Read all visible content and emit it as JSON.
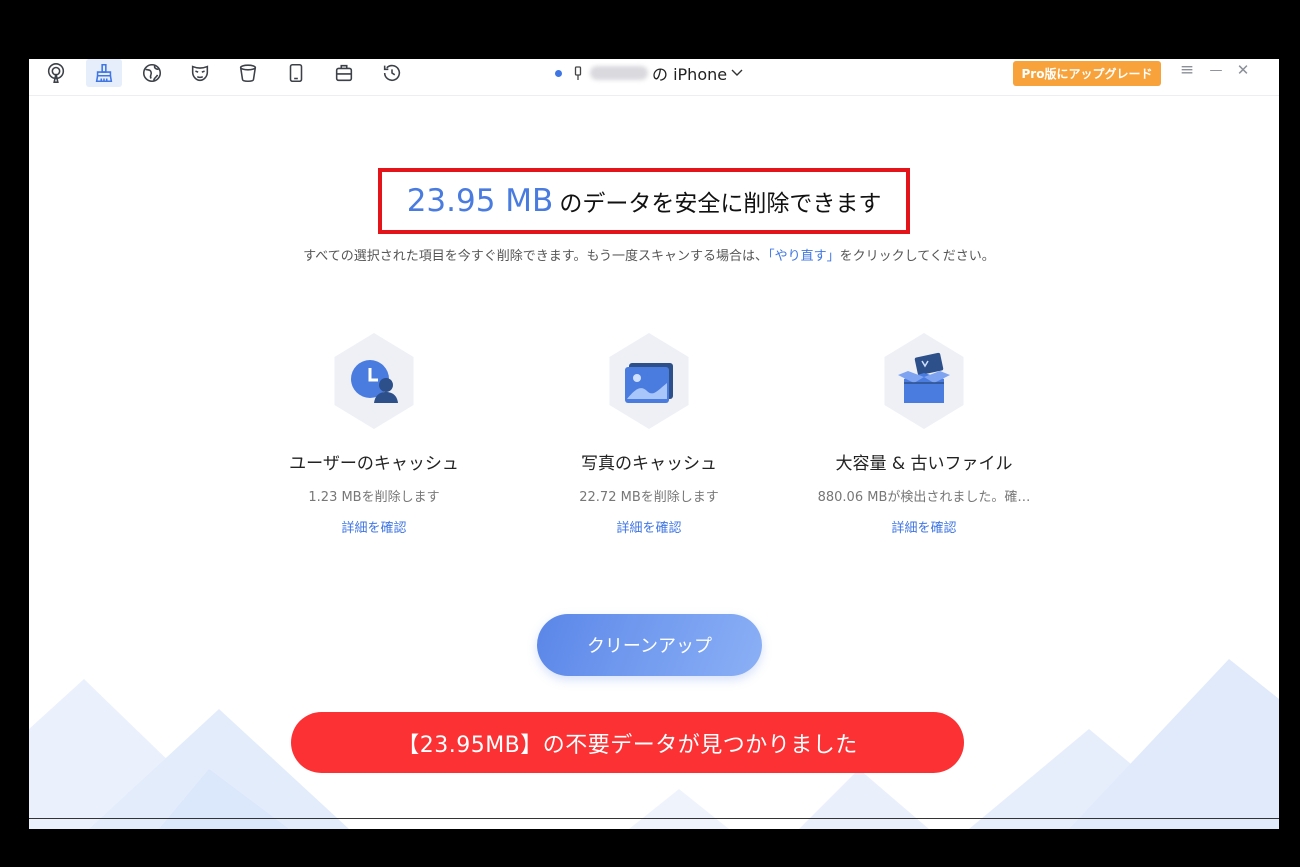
{
  "toolbar": {
    "icons": [
      "podcast-icon",
      "broom-icon",
      "globe-icon",
      "mask-icon",
      "bucket-icon",
      "phone-icon",
      "toolbox-icon",
      "history-icon"
    ],
    "active_index": 1,
    "device_name": "の iPhone",
    "upgrade_label": "Pro版にアップグレード",
    "menu_glyph": "≡",
    "minimize_glyph": "—",
    "close_glyph": "✕"
  },
  "headline": {
    "size": "23.95 MB",
    "text": "のデータを安全に削除できます"
  },
  "subtitle": {
    "before": "すべての選択された項目を今すぐ削除できます。もう一度スキャンする場合は、",
    "link": "「やり直す」",
    "after": "をクリックしてください。"
  },
  "cards": [
    {
      "icon": "user-clock-icon",
      "title": "ユーザーのキャッシュ",
      "desc": "1.23 MBを削除します",
      "link": "詳細を確認"
    },
    {
      "icon": "photo-icon",
      "title": "写真のキャッシュ",
      "desc": "22.72 MBを削除します",
      "link": "詳細を確認"
    },
    {
      "icon": "open-box-icon",
      "title": "大容量 & 古いファイル",
      "desc": "880.06 MBが検出されました。確…",
      "link": "詳細を確認"
    }
  ],
  "cleanup_label": "クリーンアップ",
  "banner_text": "【23.95MB】の不要データが見つかりました",
  "colors": {
    "accent": "#3f76e4",
    "upgrade": "#f7a23a",
    "highlight_border": "#e3141a",
    "banner": "#fb3134"
  }
}
